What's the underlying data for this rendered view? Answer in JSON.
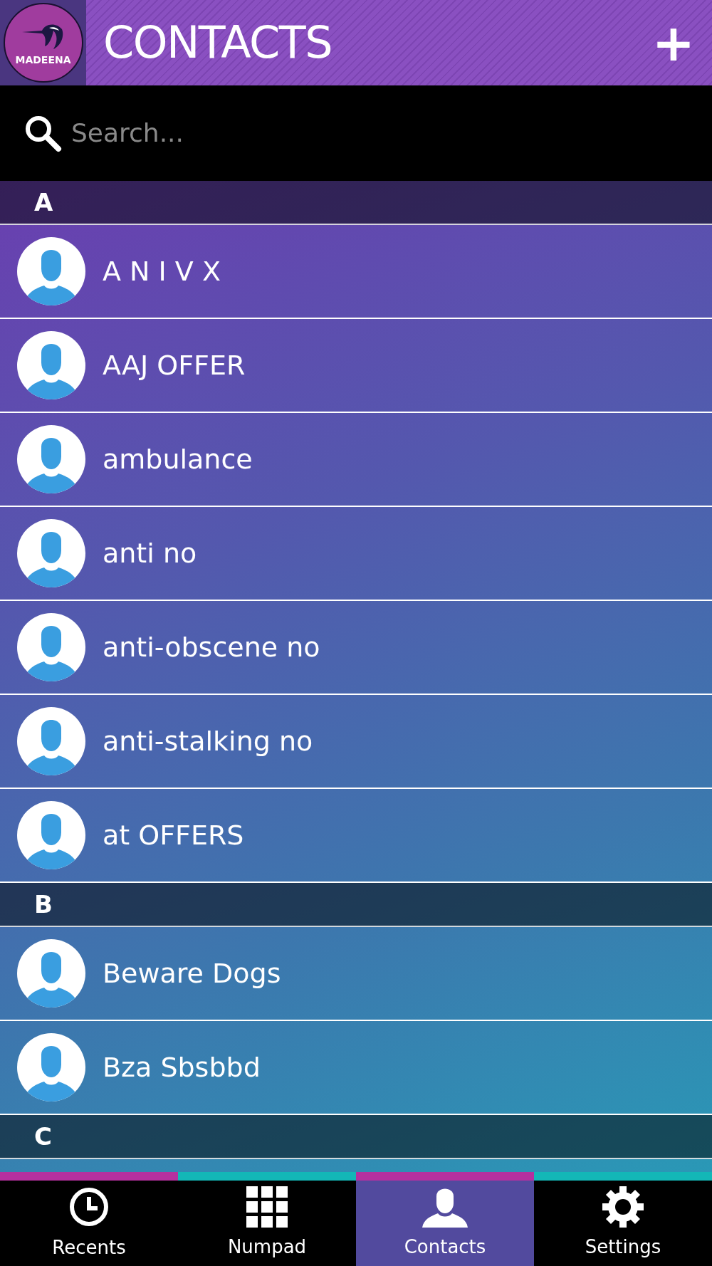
{
  "header": {
    "logo_text": "MADEENA",
    "title": "CONTACTS",
    "add_button": "+"
  },
  "search": {
    "placeholder": "Search..."
  },
  "sections": [
    {
      "letter": "A",
      "contacts": [
        {
          "name": "A N I V X"
        },
        {
          "name": "AAJ OFFER"
        },
        {
          "name": "ambulance"
        },
        {
          "name": "anti no"
        },
        {
          "name": "anti-obscene no"
        },
        {
          "name": "anti-stalking no"
        },
        {
          "name": "at OFFERS"
        }
      ]
    },
    {
      "letter": "B",
      "contacts": [
        {
          "name": "Beware Dogs"
        },
        {
          "name": "Bza Sbsbbd"
        }
      ]
    },
    {
      "letter": "C"
    }
  ],
  "tabs": [
    {
      "label": "Recents",
      "kind": "clock",
      "selected": false
    },
    {
      "label": "Numpad",
      "kind": "grid",
      "selected": false
    },
    {
      "label": "Contacts",
      "kind": "person",
      "selected": true
    },
    {
      "label": "Settings",
      "kind": "gear",
      "selected": false
    }
  ]
}
